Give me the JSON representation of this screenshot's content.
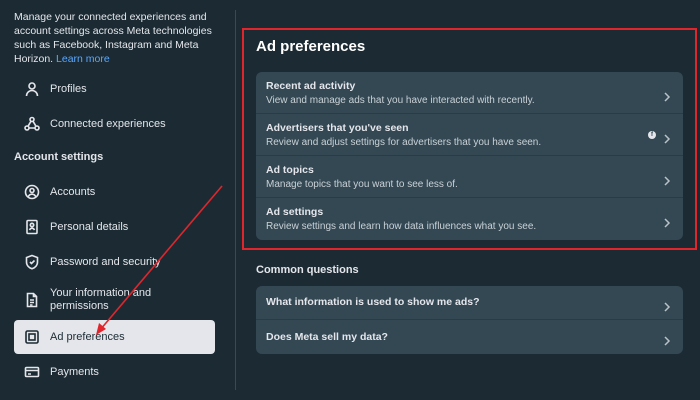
{
  "sidebar": {
    "intro_text": "Manage your connected experiences and account settings across Meta technologies such as Facebook, Instagram and Meta Horizon.",
    "intro_link": "Learn more",
    "items_top": [
      {
        "label": "Profiles",
        "icon": "person-icon"
      },
      {
        "label": "Connected experiences",
        "icon": "connected-nodes-icon"
      }
    ],
    "section_label": "Account settings",
    "items": [
      {
        "label": "Accounts",
        "icon": "account-circle-icon"
      },
      {
        "label": "Personal details",
        "icon": "id-card-icon"
      },
      {
        "label": "Password and security",
        "icon": "shield-icon"
      },
      {
        "label": "Your information and permissions",
        "icon": "info-doc-icon"
      },
      {
        "label": "Ad preferences",
        "icon": "ad-icon",
        "active": true
      },
      {
        "label": "Payments",
        "icon": "credit-card-icon"
      }
    ]
  },
  "main": {
    "title": "Ad preferences",
    "rows": [
      {
        "title": "Recent ad activity",
        "subtitle": "View and manage ads that you have interacted with recently."
      },
      {
        "title": "Advertisers that you've seen",
        "subtitle": "Review and adjust settings for advertisers that you have seen."
      },
      {
        "title": "Ad topics",
        "subtitle": "Manage topics that you want to see less of."
      },
      {
        "title": "Ad settings",
        "subtitle": "Review settings and learn how data influences what you see."
      }
    ],
    "common_title": "Common questions",
    "questions": [
      {
        "title": "What information is used to show me ads?"
      },
      {
        "title": "Does Meta sell my data?"
      }
    ]
  },
  "colors": {
    "background": "#1c2b33",
    "card": "#344854",
    "highlight": "#e0262c",
    "link": "#5aa7ff",
    "active_item": "#e4e6eb"
  }
}
